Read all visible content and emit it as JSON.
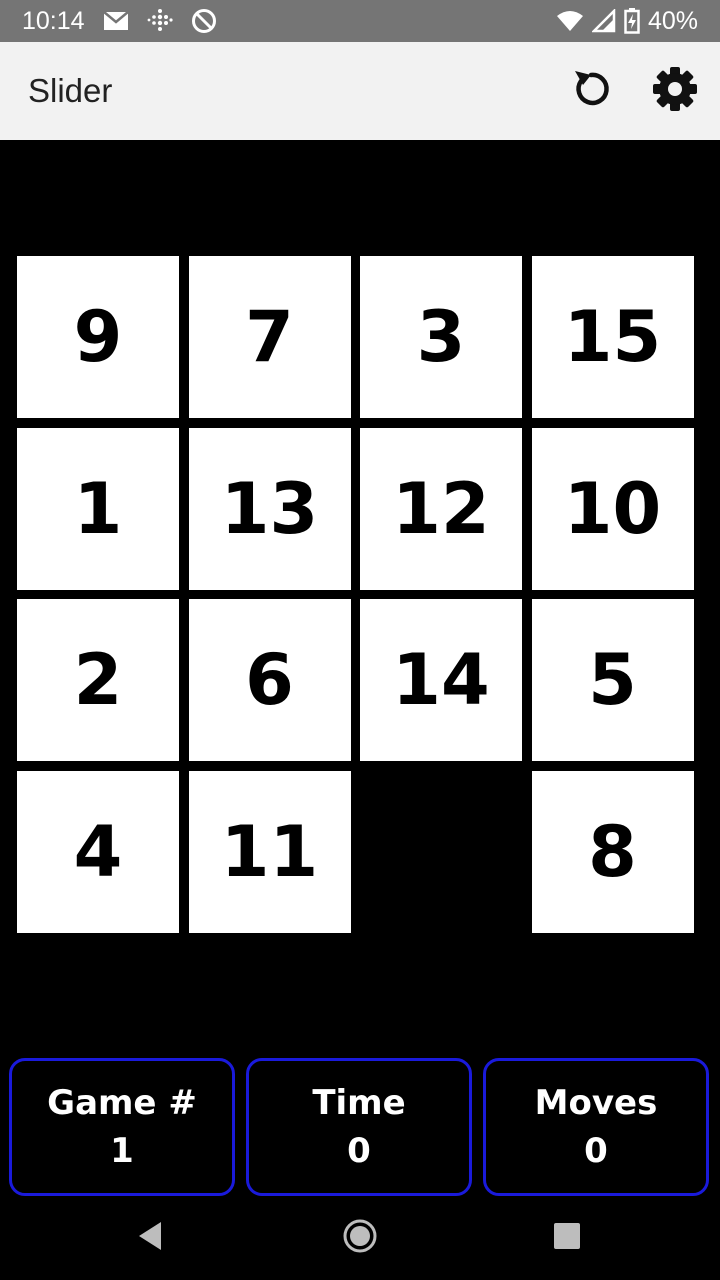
{
  "status_bar": {
    "time": "10:14",
    "battery": "40%",
    "icons": [
      "mail-icon",
      "fitbit-icon",
      "do-not-disturb-icon",
      "wifi-icon",
      "signal-icon",
      "battery-charging-icon"
    ]
  },
  "app_bar": {
    "title": "Slider",
    "actions": [
      {
        "name": "restart",
        "icon": "restart-icon"
      },
      {
        "name": "settings",
        "icon": "gear-icon"
      }
    ]
  },
  "board": {
    "size": 4,
    "tiles": [
      [
        "9",
        "7",
        "3",
        "15"
      ],
      [
        "1",
        "13",
        "12",
        "10"
      ],
      [
        "2",
        "6",
        "14",
        "5"
      ],
      [
        "4",
        "11",
        "",
        "8"
      ]
    ],
    "empty_cell": {
      "row": 3,
      "col": 2
    }
  },
  "stats": {
    "game": {
      "label": "Game #",
      "value": "1"
    },
    "time": {
      "label": "Time",
      "value": "0"
    },
    "moves": {
      "label": "Moves",
      "value": "0"
    }
  },
  "colors": {
    "status_bar": "#757575",
    "app_bar": "#f2f2f2",
    "background": "#000000",
    "tile": "#ffffff",
    "stat_border": "#1a1adb"
  },
  "nav_bar": {
    "buttons": [
      "back-icon",
      "home-icon",
      "recents-icon"
    ]
  }
}
